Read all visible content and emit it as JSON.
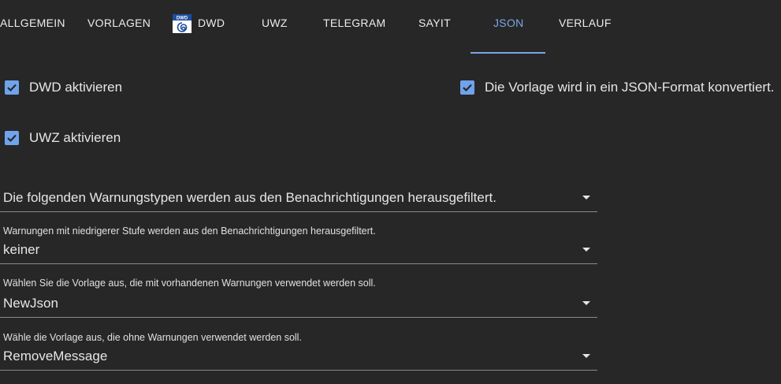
{
  "tabs": [
    {
      "label": "ALLGEMEIN"
    },
    {
      "label": "VORLAGEN"
    },
    {
      "label": "DWD",
      "icon": "dwd-logo-icon"
    },
    {
      "label": "UWZ"
    },
    {
      "label": "TELEGRAM"
    },
    {
      "label": "SAYIT"
    },
    {
      "label": "JSON",
      "active": true
    },
    {
      "label": "VERLAUF"
    }
  ],
  "dwd_logo_text": "DWD",
  "checkboxes": {
    "dwd": {
      "label": "DWD aktivieren",
      "checked": true
    },
    "uwz": {
      "label": "UWZ aktivieren",
      "checked": true
    },
    "json": {
      "label": "Die Vorlage wird in ein JSON-Format konvertiert.",
      "checked": true
    }
  },
  "fields": {
    "filter_types": {
      "placeholder": "Die folgenden Warnungstypen werden aus den Benachrichtigungen herausgefiltert."
    },
    "level": {
      "label": "Warnungen mit niedrigerer Stufe werden aus den Benachrichtigungen herausgefiltert.",
      "value": "keiner"
    },
    "template_with": {
      "label": "Wählen Sie die Vorlage aus, die mit vorhandenen Warnungen verwendet werden soll.",
      "value": "NewJson"
    },
    "template_without": {
      "label": "Wähle die Vorlage aus, die ohne Warnungen verwendet werden soll.",
      "value": "RemoveMessage"
    }
  },
  "colors": {
    "accent": "#7ba7e8",
    "checkbox": "#6fa3ec",
    "background": "#272727"
  }
}
